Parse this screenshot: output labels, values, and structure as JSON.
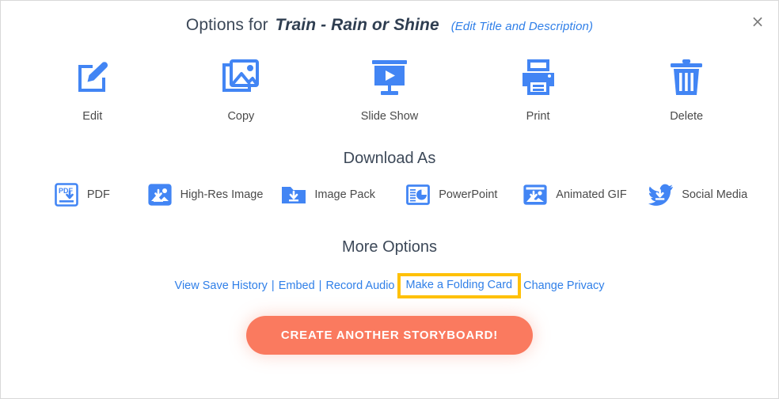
{
  "colors": {
    "icon_blue": "#4285f4",
    "link_blue": "#2f7fe8",
    "heading": "#3c4858",
    "highlight": "#ffc107",
    "cta_bg": "#fa7a5f",
    "border": "#d8d8d8"
  },
  "header": {
    "prefix": "Options for",
    "doc_title": "Train - Rain or Shine",
    "edit_link": "(Edit Title and Description)",
    "close_label": "×",
    "close_icon": "close-icon"
  },
  "primary_actions": [
    {
      "label": "Edit",
      "icon": "edit-pencil-icon"
    },
    {
      "label": "Copy",
      "icon": "copy-images-icon"
    },
    {
      "label": "Slide Show",
      "icon": "slideshow-projector-icon"
    },
    {
      "label": "Print",
      "icon": "printer-icon"
    },
    {
      "label": "Delete",
      "icon": "trash-icon"
    }
  ],
  "download": {
    "heading": "Download As",
    "items": [
      {
        "label": "PDF",
        "icon": "pdf-download-icon"
      },
      {
        "label": "High-Res Image",
        "icon": "high-res-image-icon"
      },
      {
        "label": "Image Pack",
        "icon": "folder-download-icon"
      },
      {
        "label": "PowerPoint",
        "icon": "powerpoint-slide-icon"
      },
      {
        "label": "Animated GIF",
        "icon": "animated-gif-icon"
      },
      {
        "label": "Social Media",
        "icon": "twitter-bird-icon"
      }
    ]
  },
  "more_options": {
    "heading": "More Options",
    "separator": "|",
    "links": [
      {
        "label": "View Save History",
        "highlighted": false
      },
      {
        "label": "Embed",
        "highlighted": false
      },
      {
        "label": "Record Audio",
        "highlighted": false
      },
      {
        "label": "Make a Folding Card",
        "highlighted": true
      },
      {
        "label": "Change Privacy",
        "highlighted": false
      }
    ]
  },
  "cta": {
    "label": "CREATE ANOTHER STORYBOARD!"
  }
}
